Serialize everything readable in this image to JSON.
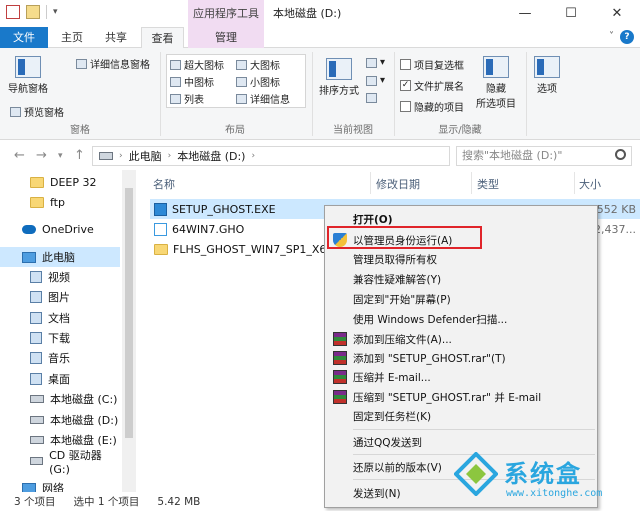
{
  "window": {
    "title": "本地磁盘 (D:)",
    "context_tab_title": "应用程序工具",
    "minimize": "—",
    "maximize": "☐",
    "close": "✕"
  },
  "ribbon_tabs": [
    "文件",
    "主页",
    "共享",
    "查看",
    "管理"
  ],
  "ribbon": {
    "pane": {
      "nav_pane": "导航窗格",
      "preview_pane": "预览窗格",
      "details_pane": "详细信息窗格",
      "label": "窗格"
    },
    "layout": {
      "items": [
        "超大图标",
        "大图标",
        "中图标",
        "小图标",
        "列表",
        "详细信息"
      ],
      "label": "布局"
    },
    "current_view": {
      "sort_by": "排序方式",
      "label": "当前视图"
    },
    "show_hide": {
      "item_checkbox": "项目复选框",
      "file_ext": "文件扩展名",
      "hidden_items": "隐藏的项目",
      "hide_selected_line1": "隐藏",
      "hide_selected_line2": "所选项目",
      "label": "显示/隐藏"
    },
    "options": "选项"
  },
  "address": {
    "crumbs": [
      "此电脑",
      "本地磁盘 (D:)"
    ],
    "search_placeholder": "搜索\"本地磁盘 (D:)\""
  },
  "nav_pane": {
    "items": [
      {
        "label": "DEEP 32",
        "icon": "folder-icon"
      },
      {
        "label": "ftp",
        "icon": "folder-icon"
      },
      {
        "label": "OneDrive",
        "icon": "onedrive-icon"
      },
      {
        "label": "此电脑",
        "icon": "pc-icon"
      },
      {
        "label": "视频",
        "icon": "videos-icon"
      },
      {
        "label": "图片",
        "icon": "pictures-icon"
      },
      {
        "label": "文档",
        "icon": "documents-icon"
      },
      {
        "label": "下载",
        "icon": "downloads-icon"
      },
      {
        "label": "音乐",
        "icon": "music-icon"
      },
      {
        "label": "桌面",
        "icon": "desktop-icon"
      },
      {
        "label": "本地磁盘 (C:)",
        "icon": "drive-icon"
      },
      {
        "label": "本地磁盘 (D:)",
        "icon": "drive-icon"
      },
      {
        "label": "本地磁盘 (E:)",
        "icon": "drive-icon"
      },
      {
        "label": "CD 驱动器 (G:)",
        "icon": "cd-drive-icon"
      },
      {
        "label": "网络",
        "icon": "network-icon"
      }
    ]
  },
  "file_list": {
    "columns": [
      "名称",
      "修改日期",
      "类型",
      "大小"
    ],
    "rows": [
      {
        "name": "SETUP_GHOST.EXE",
        "size": "5,552 KB"
      },
      {
        "name": "64WIN7.GHO",
        "size": "372,437..."
      },
      {
        "name": "FLHS_GHOST_WIN7_SP1_X64_V",
        "size": ""
      }
    ]
  },
  "context_menu": {
    "items": [
      "打开(O)",
      "以管理员身份运行(A)",
      "管理员取得所有权",
      "兼容性疑难解答(Y)",
      "固定到\"开始\"屏幕(P)",
      "使用 Windows Defender扫描...",
      "添加到压缩文件(A)...",
      "添加到 \"SETUP_GHOST.rar\"(T)",
      "压缩并 E-mail...",
      "压缩到 \"SETUP_GHOST.rar\" 并 E-mail",
      "固定到任务栏(K)",
      "通过QQ发送到",
      "还原以前的版本(V)",
      "发送到(N)"
    ]
  },
  "status": {
    "count": "3 个项目",
    "selected": "选中 1 个项目",
    "size": "5.42 MB"
  },
  "watermark": {
    "brand": "系统盒",
    "url": "www.xitonghe.com"
  },
  "colors": {
    "accent": "#1979ca",
    "selection": "#cce8ff",
    "manage_tab": "#f1dcf2",
    "highlight_border": "#e0242a"
  }
}
